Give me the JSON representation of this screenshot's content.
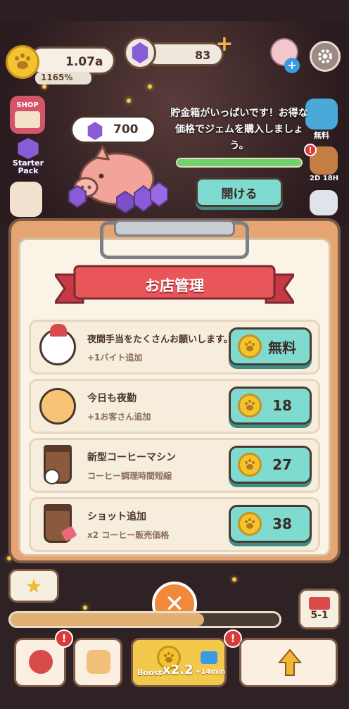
{
  "hud": {
    "coins": "1.07a",
    "income_rate": "1165%",
    "gems": "83"
  },
  "side_left": {
    "shop_label": "SHOP",
    "starter_pack_label": "Starter Pack"
  },
  "side_right": {
    "free_label": "無料",
    "timer_label": "2D 18H"
  },
  "piggy": {
    "gem_amount": "700",
    "message": "貯金箱がいっぱいです！お得な価格でジェムを購入しましょう。",
    "progress": 1.0,
    "open_button": "開ける"
  },
  "panel": {
    "title": "お店管理",
    "rows": [
      {
        "title": "夜間手当をたくさんお願いします。",
        "subtitle": "+1バイト追加",
        "price": "無料",
        "icon": "white-cat-santa-hat-icon"
      },
      {
        "title": "今日も夜勤",
        "subtitle": "+1お客さん追加",
        "price": "18",
        "icon": "orange-tabby-cat-icon"
      },
      {
        "title": "新型コーヒーマシン",
        "subtitle": "コーヒー調理時間短縮",
        "price": "27",
        "icon": "coffee-cup-clock-icon"
      },
      {
        "title": "ショット追加",
        "subtitle": "x2 コーヒー販売価格",
        "price": "38",
        "icon": "coffee-cup-tag-icon"
      }
    ],
    "close_icon": "close-x-icon"
  },
  "bottom": {
    "stage_label": "5-1",
    "boost_label": "Boost",
    "boost_multiplier": "x2.2",
    "boost_time": "+14min",
    "progress": 0.72,
    "badge_text": "!"
  },
  "colors": {
    "accent_teal": "#7fdad0",
    "ribbon_red": "#e8565a",
    "panel_orange": "#e4a572",
    "coin_gold": "#f4c430",
    "gem_purple": "#8a5bd6"
  }
}
